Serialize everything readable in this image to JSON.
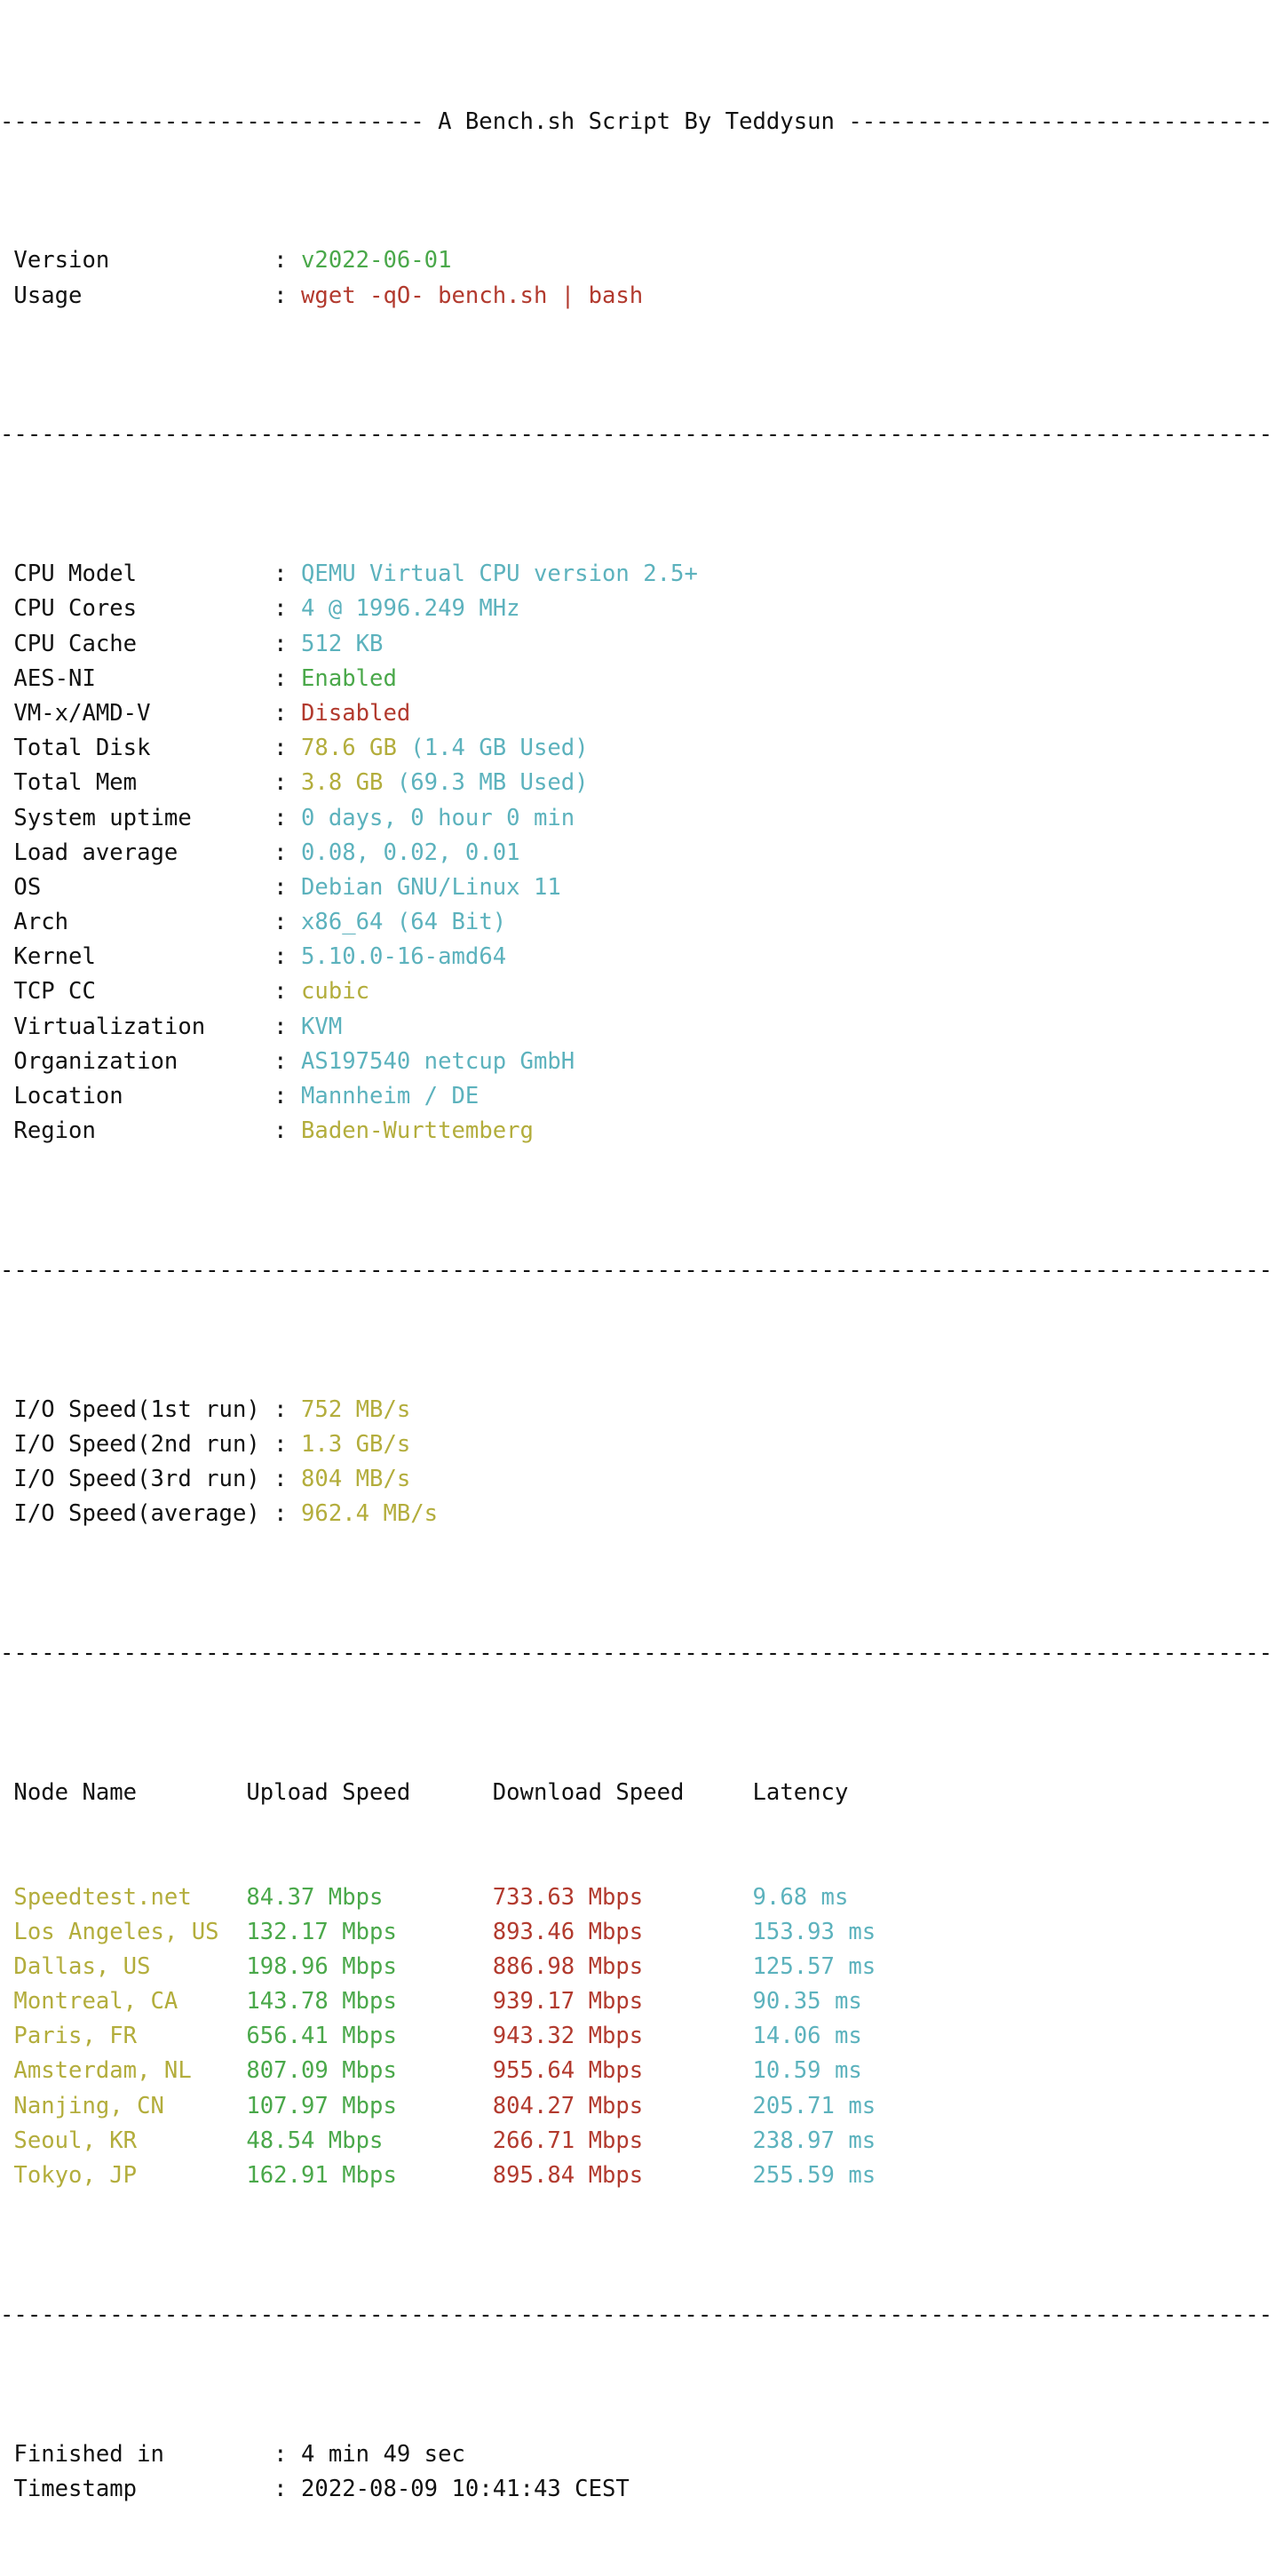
{
  "colors": {
    "green": "#4aa84a",
    "red": "#b23a2e",
    "cyan": "#5cb2bd",
    "yellow": "#b3ad3c",
    "plain": "#111111",
    "background": "#ffffff"
  },
  "header": {
    "left_dashes": "-------------------",
    "title": " A Bench.sh Script By Teddysun ",
    "right_dashes": "-------------------"
  },
  "separator": "----------------------------------------------------------------------",
  "intro": {
    "rows": [
      {
        "label": "Version",
        "value": "v2022-06-01",
        "color": "green"
      },
      {
        "label": "Usage",
        "value": "wget -qO- bench.sh | bash",
        "color": "red"
      }
    ]
  },
  "sysinfo": {
    "rows": [
      {
        "label": "CPU Model",
        "value": "QEMU Virtual CPU version 2.5+",
        "color": "cyan"
      },
      {
        "label": "CPU Cores",
        "value": "4 @ 1996.249 MHz",
        "color": "cyan"
      },
      {
        "label": "CPU Cache",
        "value": "512 KB",
        "color": "cyan"
      },
      {
        "label": "AES-NI",
        "value": "Enabled",
        "color": "green"
      },
      {
        "label": "VM-x/AMD-V",
        "value": "Disabled",
        "color": "red"
      },
      {
        "label": "Total Disk",
        "value": "78.6 GB",
        "extra": " (1.4 GB Used)",
        "color": "yellow",
        "extra_color": "cyan"
      },
      {
        "label": "Total Mem",
        "value": "3.8 GB",
        "extra": " (69.3 MB Used)",
        "color": "yellow",
        "extra_color": "cyan"
      },
      {
        "label": "System uptime",
        "value": "0 days, 0 hour 0 min",
        "color": "cyan"
      },
      {
        "label": "Load average",
        "value": "0.08, 0.02, 0.01",
        "color": "cyan"
      },
      {
        "label": "OS",
        "value": "Debian GNU/Linux 11",
        "color": "cyan"
      },
      {
        "label": "Arch",
        "value": "x86_64 (64 Bit)",
        "color": "cyan"
      },
      {
        "label": "Kernel",
        "value": "5.10.0-16-amd64",
        "color": "cyan"
      },
      {
        "label": "TCP CC",
        "value": "cubic",
        "color": "yellow"
      },
      {
        "label": "Virtualization",
        "value": "KVM",
        "color": "cyan"
      },
      {
        "label": "Organization",
        "value": "AS197540 netcup GmbH",
        "color": "cyan"
      },
      {
        "label": "Location",
        "value": "Mannheim / DE",
        "color": "cyan"
      },
      {
        "label": "Region",
        "value": "Baden-Wurttemberg",
        "color": "yellow"
      }
    ]
  },
  "iospeed": {
    "rows": [
      {
        "label": "I/O Speed(1st run)",
        "value": "752 MB/s",
        "color": "yellow"
      },
      {
        "label": "I/O Speed(2nd run)",
        "value": "1.3 GB/s",
        "color": "yellow"
      },
      {
        "label": "I/O Speed(3rd run)",
        "value": "804 MB/s",
        "color": "yellow"
      },
      {
        "label": "I/O Speed(average)",
        "value": "962.4 MB/s",
        "color": "yellow"
      }
    ]
  },
  "speedtest": {
    "headers": [
      "Node Name",
      "Upload Speed",
      "Download Speed",
      "Latency"
    ],
    "rows": [
      {
        "node": "Speedtest.net",
        "upload": "84.37 Mbps",
        "download": "733.63 Mbps",
        "latency": "9.68 ms"
      },
      {
        "node": "Los Angeles, US",
        "upload": "132.17 Mbps",
        "download": "893.46 Mbps",
        "latency": "153.93 ms"
      },
      {
        "node": "Dallas, US",
        "upload": "198.96 Mbps",
        "download": "886.98 Mbps",
        "latency": "125.57 ms"
      },
      {
        "node": "Montreal, CA",
        "upload": "143.78 Mbps",
        "download": "939.17 Mbps",
        "latency": "90.35 ms"
      },
      {
        "node": "Paris, FR",
        "upload": "656.41 Mbps",
        "download": "943.32 Mbps",
        "latency": "14.06 ms"
      },
      {
        "node": "Amsterdam, NL",
        "upload": "807.09 Mbps",
        "download": "955.64 Mbps",
        "latency": "10.59 ms"
      },
      {
        "node": "Nanjing, CN",
        "upload": "107.97 Mbps",
        "download": "804.27 Mbps",
        "latency": "205.71 ms"
      },
      {
        "node": "Seoul, KR",
        "upload": "48.54 Mbps",
        "download": "266.71 Mbps",
        "latency": "238.97 ms"
      },
      {
        "node": "Tokyo, JP",
        "upload": "162.91 Mbps",
        "download": "895.84 Mbps",
        "latency": "255.59 ms"
      }
    ]
  },
  "footer": {
    "rows": [
      {
        "label": "Finished in",
        "value": "4 min 49 sec",
        "color": "plain"
      },
      {
        "label": "Timestamp",
        "value": "2022-08-09 10:41:43 CEST",
        "color": "plain"
      }
    ]
  }
}
